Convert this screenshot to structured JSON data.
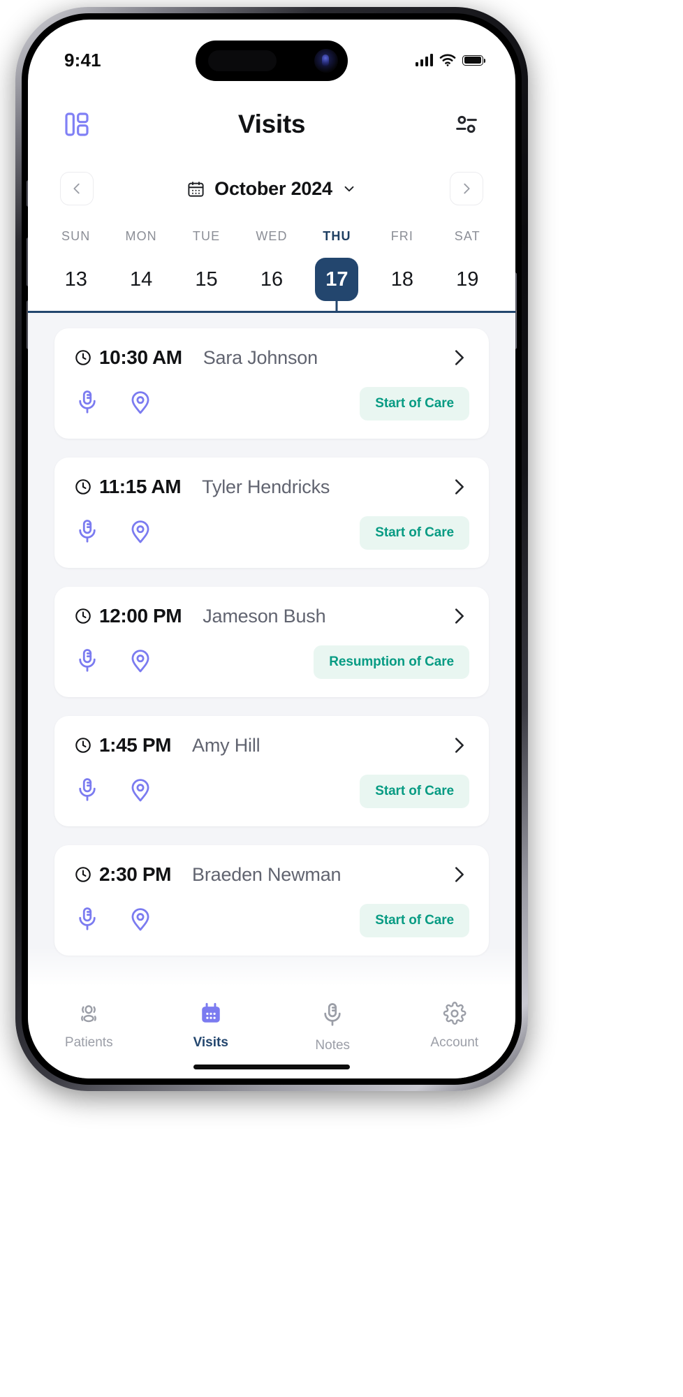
{
  "status_bar": {
    "time": "9:41",
    "signal_icon": "cellular-signal-icon",
    "wifi_icon": "wifi-icon",
    "battery_icon": "battery-full-icon"
  },
  "header": {
    "menu_icon": "dashboard-layout-icon",
    "title": "Visits",
    "filter_icon": "filter-settings-icon"
  },
  "month_selector": {
    "prev_label": "‹",
    "next_label": "›",
    "calendar_icon": "calendar-icon",
    "month": "October 2024",
    "chevron_icon": "chevron-down-icon"
  },
  "week": {
    "days": [
      {
        "weekday": "SUN",
        "date": "13",
        "selected": false
      },
      {
        "weekday": "MON",
        "date": "14",
        "selected": false
      },
      {
        "weekday": "TUE",
        "date": "15",
        "selected": false
      },
      {
        "weekday": "WED",
        "date": "16",
        "selected": false
      },
      {
        "weekday": "THU",
        "date": "17",
        "selected": true
      },
      {
        "weekday": "FRI",
        "date": "18",
        "selected": false
      },
      {
        "weekday": "SAT",
        "date": "19",
        "selected": false
      }
    ]
  },
  "visits": [
    {
      "time": "10:30 AM",
      "patient": "Sara Johnson",
      "badge": "Start of Care",
      "clock_icon": "clock-icon",
      "mic_icon": "microphone-icon",
      "location_icon": "location-pin-icon",
      "chevron_icon": "chevron-right-icon"
    },
    {
      "time": "11:15 AM",
      "patient": "Tyler Hendricks",
      "badge": "Start of Care",
      "clock_icon": "clock-icon",
      "mic_icon": "microphone-icon",
      "location_icon": "location-pin-icon",
      "chevron_icon": "chevron-right-icon"
    },
    {
      "time": "12:00 PM",
      "patient": "Jameson Bush",
      "badge": "Resumption of Care",
      "clock_icon": "clock-icon",
      "mic_icon": "microphone-icon",
      "location_icon": "location-pin-icon",
      "chevron_icon": "chevron-right-icon"
    },
    {
      "time": "1:45 PM",
      "patient": "Amy Hill",
      "badge": "Start of Care",
      "clock_icon": "clock-icon",
      "mic_icon": "microphone-icon",
      "location_icon": "location-pin-icon",
      "chevron_icon": "chevron-right-icon"
    },
    {
      "time": "2:30 PM",
      "patient": "Braeden Newman",
      "badge": "Start of Care",
      "clock_icon": "clock-icon",
      "mic_icon": "microphone-icon",
      "location_icon": "location-pin-icon",
      "chevron_icon": "chevron-right-icon"
    }
  ],
  "tab_bar": {
    "items": [
      {
        "label": "Patients",
        "icon": "people-group-icon",
        "active": false
      },
      {
        "label": "Visits",
        "icon": "calendar-icon",
        "active": true
      },
      {
        "label": "Notes",
        "icon": "microphone-icon",
        "active": false
      },
      {
        "label": "Account",
        "icon": "gear-icon",
        "active": false
      }
    ]
  },
  "colors": {
    "accent_purple": "#7b7bf0",
    "navy": "#23466e",
    "badge_text": "#079b83",
    "badge_bg": "#e9f6f1",
    "list_bg": "#f4f5f8",
    "muted_text": "#8b8e96"
  }
}
